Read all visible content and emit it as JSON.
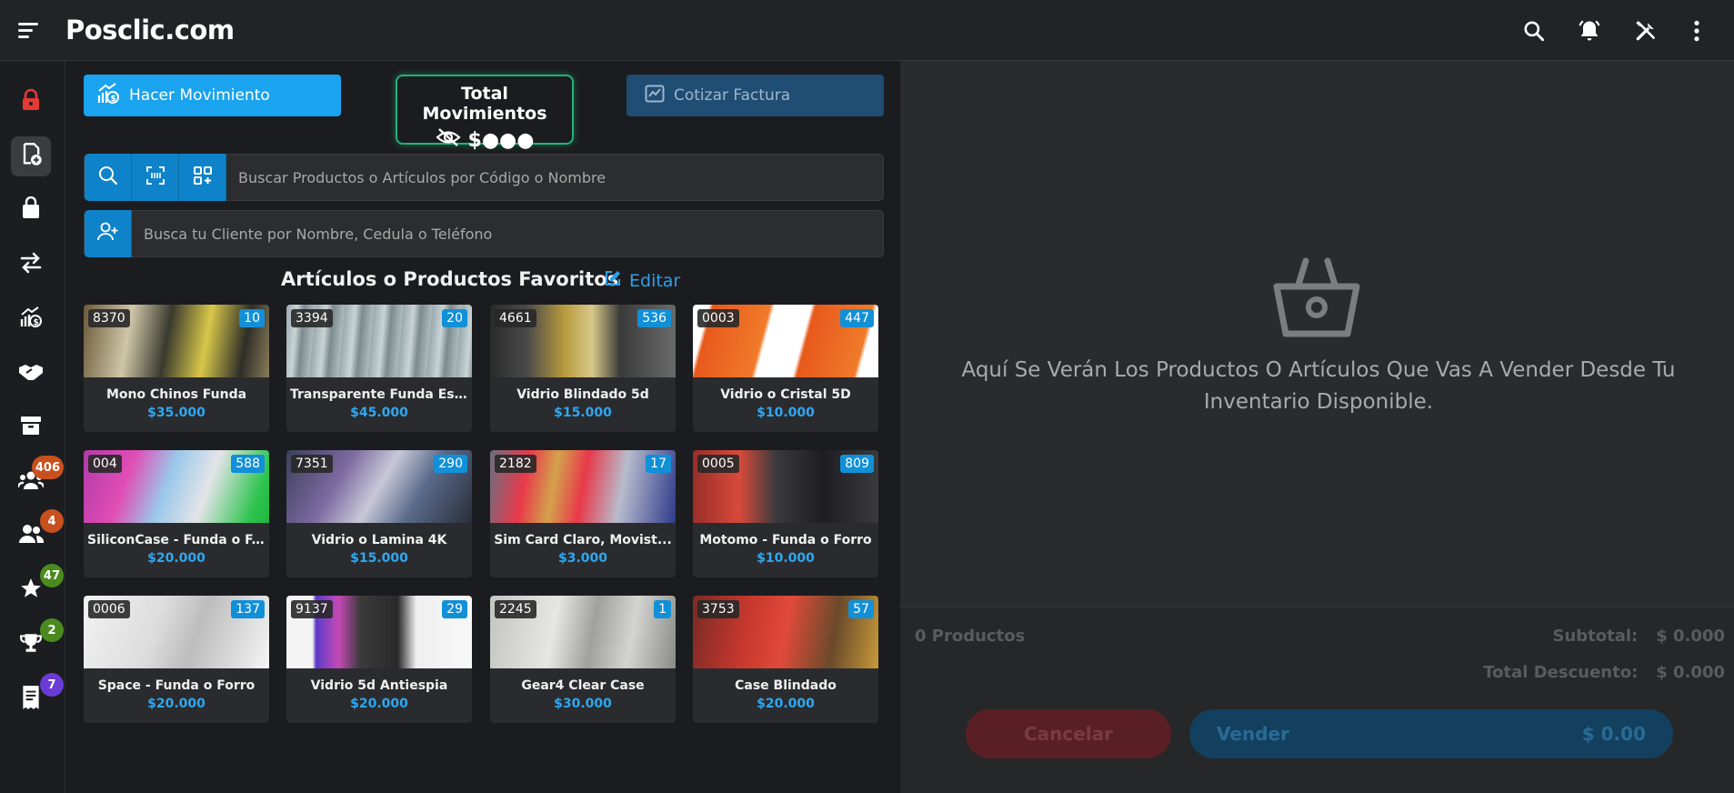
{
  "app": {
    "brand": "Posclic.com"
  },
  "sidebar": {
    "badges": {
      "clients": "406",
      "users": "4",
      "favorites": "47",
      "trophies": "2",
      "receipts": "7"
    }
  },
  "actions": {
    "hacer_movimiento": "Hacer Movimiento",
    "total_movimientos_title": "Total Movimientos",
    "total_movimientos_value": "$●●●",
    "cotizar_factura": "Cotizar Factura"
  },
  "search": {
    "products_placeholder": "Buscar Productos o Artículos por Código o Nombre",
    "client_placeholder": "Busca tu Cliente por Nombre, Cedula o Teléfono"
  },
  "favorites": {
    "title": "Artículos o Productos Favoritos",
    "edit_label": "Editar",
    "items": [
      {
        "code": "8370",
        "stock": "10",
        "name": "Mono Chinos Funda",
        "price": "$35.000"
      },
      {
        "code": "3394",
        "stock": "20",
        "name": "Transparente Funda Es...",
        "price": "$45.000"
      },
      {
        "code": "4661",
        "stock": "536",
        "name": "Vidrio Blindado 5d",
        "price": "$15.000"
      },
      {
        "code": "0003",
        "stock": "447",
        "name": "Vidrio o Cristal 5D",
        "price": "$10.000"
      },
      {
        "code": "004",
        "stock": "588",
        "name": "SiliconCase - Funda o F...",
        "price": "$20.000"
      },
      {
        "code": "7351",
        "stock": "290",
        "name": "Vidrio o Lamina 4K",
        "price": "$15.000"
      },
      {
        "code": "2182",
        "stock": "17",
        "name": "Sim Card Claro, Movist...",
        "price": "$3.000"
      },
      {
        "code": "0005",
        "stock": "809",
        "name": "Motomo - Funda o Forro",
        "price": "$10.000"
      },
      {
        "code": "0006",
        "stock": "137",
        "name": "Space - Funda o Forro",
        "price": "$20.000"
      },
      {
        "code": "9137",
        "stock": "29",
        "name": "Vidrio 5d Antiespia",
        "price": "$20.000"
      },
      {
        "code": "2245",
        "stock": "1",
        "name": "Gear4 Clear Case",
        "price": "$30.000"
      },
      {
        "code": "3753",
        "stock": "57",
        "name": "Case Blindado",
        "price": "$20.000"
      }
    ]
  },
  "cart": {
    "empty_message": "Aquí Se Verán Los Productos O Artículos Que Vas A Vender Desde Tu Inventario Disponible.",
    "product_count": "0 Productos",
    "subtotal_label": "Subtotal:",
    "subtotal_value": "$ 0.000",
    "discount_label": "Total Descuento:",
    "discount_value": "$ 0.000",
    "cancel_label": "Cancelar",
    "sell_label": "Vender",
    "sell_value": "$ 0.00"
  },
  "colors": {
    "accent": "#1aa3ee",
    "price": "#2fa7f0",
    "lock": "#e53935",
    "badge_orange": "#c8501e",
    "badge_green": "#4a8a1e",
    "badge_purple": "#6a3bd6"
  }
}
